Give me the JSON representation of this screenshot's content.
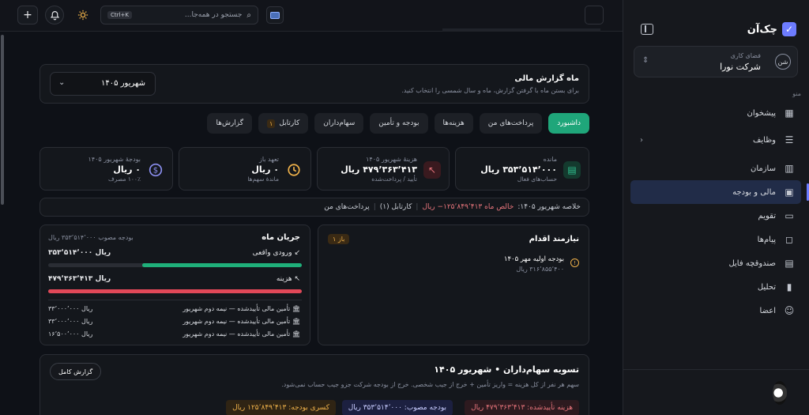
{
  "sidebar": {
    "brand": "چک‌آن",
    "workspace": {
      "label": "فضای کاری",
      "value": "شرکت نورا",
      "badge": "شن"
    },
    "menu_caption": "منو",
    "items": [
      {
        "label": "پیشخوان",
        "icon": "dashboard-icon"
      },
      {
        "label": "وظایف",
        "icon": "tasks-icon",
        "has_submenu": true
      },
      {
        "label": "سازمان",
        "icon": "building-icon"
      },
      {
        "label": "مالی و بودجه",
        "icon": "wallet-icon",
        "active": true
      },
      {
        "label": "تقویم",
        "icon": "calendar-icon"
      },
      {
        "label": "پیام‌ها",
        "icon": "chat-icon"
      },
      {
        "label": "صندوقچه فایل",
        "icon": "archive-icon"
      },
      {
        "label": "تحلیل",
        "icon": "chart-icon"
      },
      {
        "label": "اعضا",
        "icon": "users-icon"
      }
    ]
  },
  "topbar": {
    "search_placeholder": "جستجو در همه‌جا...",
    "search_shortcut": "Ctrl+K"
  },
  "month": {
    "title": "ماه گزارش مالی",
    "subtitle": "برای بستن ماه با گرفتن گزارش، ماه و سال شمسی را انتخاب کنید.",
    "selected": "شهریور ۱۴۰۵"
  },
  "tabs": [
    {
      "label": "داشبورد",
      "active": true
    },
    {
      "label": "پرداخت‌های من"
    },
    {
      "label": "هزینه‌ها"
    },
    {
      "label": "بودجه و تأمین"
    },
    {
      "label": "سهام‌داران"
    },
    {
      "label": "کارتابل",
      "count": "۱"
    },
    {
      "label": "گزارش‌ها"
    }
  ],
  "kpis": [
    {
      "title": "مانده",
      "value": "۳۵۳٬۵۱۴٬۰۰۰ ریال",
      "sub": "حساب‌های فعال",
      "color": "#2fc08f"
    },
    {
      "title": "هزینهٔ شهریور ۱۴۰۵",
      "value": "۴۷۹٬۳۶۳٬۴۱۳ ریال",
      "sub": "تأیید / پرداخت‌شده",
      "color": "#e8757c"
    },
    {
      "title": "تعهد باز",
      "value": "۰ ریال",
      "sub": "ماندهٔ سهم‌ها",
      "color": "#f0b24a"
    },
    {
      "title": "بودجهٔ شهریور ۱۴۰۵",
      "value": "۰ ریال",
      "sub": "۱۰۰٪ مصرف",
      "color": "#8b8ff0"
    }
  ],
  "summary": {
    "prefix": "خلاصه شهریور ۱۴۰۵:",
    "net": "خالص ماه ۱۲۵٬۸۴۹٬۴۱۳− ریال",
    "inbox": "کارتابل (۱)",
    "payments": "پرداخت‌های من"
  },
  "flow": {
    "title": "جریان ماه",
    "budget": "بودجه مصوب ۳۵۳٬۵۱۴٬۰۰۰ ریال",
    "income_label": "ورودی واقعی",
    "income_value": "۳۵۳٬۵۱۴٬۰۰۰ ریال",
    "income_ratio": 0.63,
    "expense_label": "هزینه",
    "expense_value": "۴۷۹٬۳۶۳٬۴۱۳ ریال",
    "expense_ratio": 1.0,
    "transactions": [
      {
        "label": "تأمین مالی تأییدشده — نیمه دوم شهریور",
        "value": "۳۳٬۰۰۰٬۰۰۰ ریال"
      },
      {
        "label": "تأمین مالی تأییدشده — نیمه دوم شهریور",
        "value": "۳۳٬۰۰۰٬۰۰۰ ریال"
      },
      {
        "label": "تأمین مالی تأییدشده — نیمه دوم شهریور",
        "value": "۱۶٬۵۰۰٬۰۰۰ ریال"
      }
    ]
  },
  "action": {
    "title": "نیازمند اقدام",
    "badge": "۱ باز",
    "item_title": "بودجه اولیه مهر ۱۴۰۵",
    "item_value": "۳۱۶٬۸۵۵٬۴۰۰ ریال"
  },
  "settle": {
    "title": "تسویه سهام‌داران • شهریور ۱۴۰۵",
    "subtitle": "سهم هر نفر از کل هزینه = واریز تأمین + خرج از جیب شخصی. خرج از بودجه شرکت جزو جیب حساب نمی‌شود.",
    "button": "گزارش کامل",
    "chips": [
      {
        "label": "هزینه تأییدشده: ۴۷۹٬۳۶۳٬۴۱۳ ریال",
        "color": "#e8757c"
      },
      {
        "label": "بودجه مصوب: ۳۵۳٬۵۱۴٬۰۰۰ ریال",
        "color": "#9aa3ff"
      },
      {
        "label": "کسری بودجه: ۱۲۵٬۸۴۹٬۴۱۳ ریال",
        "color": "#f0b24a"
      }
    ]
  }
}
